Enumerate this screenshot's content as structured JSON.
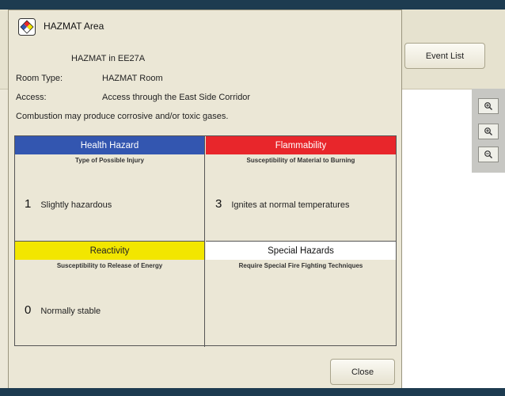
{
  "background": {
    "event_list_label": "Event List",
    "zoom_buttons": [
      "zoom-in-icon",
      "zoom-icon",
      "zoom-out-icon"
    ]
  },
  "dialog": {
    "title": "HAZMAT Area",
    "icon": "nfpa-diamond-icon",
    "location": "HAZMAT in EE27A",
    "room_type_label": "Room Type:",
    "room_type_value": "HAZMAT Room",
    "access_label": "Access:",
    "access_value": "Access through the East Side Corridor",
    "combustion_note": "Combustion may produce corrosive and/or toxic gases.",
    "cells": {
      "health": {
        "title": "Health Hazard",
        "subtitle": "Type of Possible Injury",
        "rating": "1",
        "description": "Slightly hazardous",
        "color": "#3356b0"
      },
      "flammability": {
        "title": "Flammability",
        "subtitle": "Susceptibility of Material to Burning",
        "rating": "3",
        "description": "Ignites at normal temperatures",
        "color": "#e8262b"
      },
      "reactivity": {
        "title": "Reactivity",
        "subtitle": "Susceptibility to Release of Energy",
        "rating": "0",
        "description": "Normally stable",
        "color": "#f2e600"
      },
      "special": {
        "title": "Special Hazards",
        "subtitle": "Require Special Fire Fighting Techniques",
        "rating": "",
        "description": "",
        "color": "#ffffff"
      }
    },
    "close_label": "Close"
  }
}
